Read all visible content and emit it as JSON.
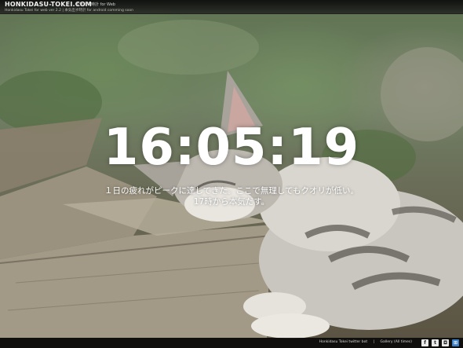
{
  "header": {
    "logo": "HONKIDASU-TOKEI.COM",
    "logo_sub": "本気出す時計 for Web",
    "subline": "Honkidasu Tokei for web ver 2.2 | 本気出す時計 for android comming soon"
  },
  "clock": {
    "time": "16:05:19"
  },
  "message": {
    "line1": "１日の疲れがピークに達してきた。ここで無理してもクオリが低い。",
    "line2": "17時から本気だす。"
  },
  "footer": {
    "link1": "Honkidasu Tokei twitter bot",
    "separator": "|",
    "link2": "Gallery (All times)",
    "social": [
      {
        "icon": "facebook-icon",
        "glyph": "f"
      },
      {
        "icon": "twitter-icon",
        "glyph": "t"
      },
      {
        "icon": "instagram-icon",
        "glyph": "◘"
      },
      {
        "icon": "windows-icon",
        "glyph": "⊞"
      }
    ]
  },
  "colors": {
    "clock_text": "#ffffff",
    "bar_bg": "#0a0a0a",
    "accent_blue": "#3d7fc4"
  }
}
